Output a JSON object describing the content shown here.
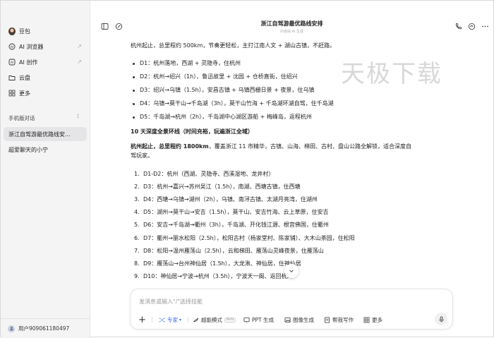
{
  "sidebar": {
    "app_name": "豆包",
    "items": [
      {
        "label": "AI 浏览器",
        "icon": "ai-browser-icon"
      },
      {
        "label": "AI 创作",
        "icon": "ai-create-icon"
      },
      {
        "label": "云盘",
        "icon": "folder-icon"
      },
      {
        "label": "更多",
        "icon": "grid-icon"
      }
    ],
    "section_title": "手机版对话",
    "conversations": [
      {
        "label": "浙江自驾游最优路线安..."
      },
      {
        "label": "超爱聊天的小宁"
      }
    ],
    "user_name": "用户909061180497"
  },
  "header": {
    "title": "浙江自驾游最优路线安排",
    "subtitle": "内容由 AI 生成"
  },
  "watermark": "天极下载",
  "content": {
    "intro": "杭州起止，总里程约 500km，节奏更轻松，主打江南人文 + 湖山古镇，不赶路。",
    "route5": [
      "D1：杭州落地，西湖 + 灵隐寺，住杭州",
      "D2：杭州→绍兴（1h），鲁迅故里 + 沈园 + 仓桥直街，住绍兴",
      "D3：绍兴→乌镇（1.5h），安昌古镇 + 乌镇西栅日景 + 夜景，住乌镇",
      "D4：乌镇→莫干山→千岛湖（3h），莫干山竹海 + 千岛湖环湖自驾，住千岛湖",
      "D5：千岛湖→杭州（2h），千岛湖中心湖区游船 + 梅峰岛，返程杭州"
    ],
    "heading10": "10 天深度全景环线（时间充裕，玩遍浙江全域）",
    "intro10_bold": "杭州起止，总里程约 1800km",
    "intro10_rest1": "，覆盖浙江 11 市精华，古镇、山海、梯田、古村、盘山公路全解锁，适合深度自",
    "intro10_rest2": "驾玩家。",
    "route10": [
      "D1-D2：杭州（西湖、灵隐寺、西溪湿地、龙井村）",
      "D3：杭州→嘉兴→苏州吴江（1.5h），南湖、西塘古镇，住西塘",
      "D4：西塘→乌镇→湖州（2h），乌镇、南浔古镇、太湖月亮湾，住湖州",
      "D5：湖州→莫干山→安吉（1.5h），莫干山、安吉竹海、云上草原，住安吉",
      "D6：安吉→千岛湖→衢州（3h），千岛湖、开化钱江源、根宫佛国，住衢州",
      "D7：衢州→丽水松阳（2.5h），松阳古村（杨家堂村、陈家铺）、大木山茶园，住松阳",
      "D8：松阳→温州雁荡山（2.5h），云和梯田、雁荡山灵峰夜景，住雁荡山",
      "D9：雁荡山→台州神仙居（1.5h），大龙湫、神仙居，住神仙居",
      "D10：神仙居→宁波→杭州（3.5h），宁波天一阁、返回杭州"
    ]
  },
  "input": {
    "placeholder": "发消息或输入\"/\"选择技能",
    "tools": [
      {
        "label": "专家",
        "icon": "expert-icon"
      },
      {
        "label": "超能模式",
        "icon": "super-mode-icon",
        "badge": "Beta"
      },
      {
        "label": "PPT 生成",
        "icon": "ppt-icon"
      },
      {
        "label": "图像生成",
        "icon": "image-icon"
      },
      {
        "label": "帮我写作",
        "icon": "write-icon"
      },
      {
        "label": "更多",
        "icon": "more-grid-icon"
      }
    ]
  },
  "colors": {
    "accent": "#3b6cf6",
    "sidebar_bg": "#f4f4f5"
  }
}
